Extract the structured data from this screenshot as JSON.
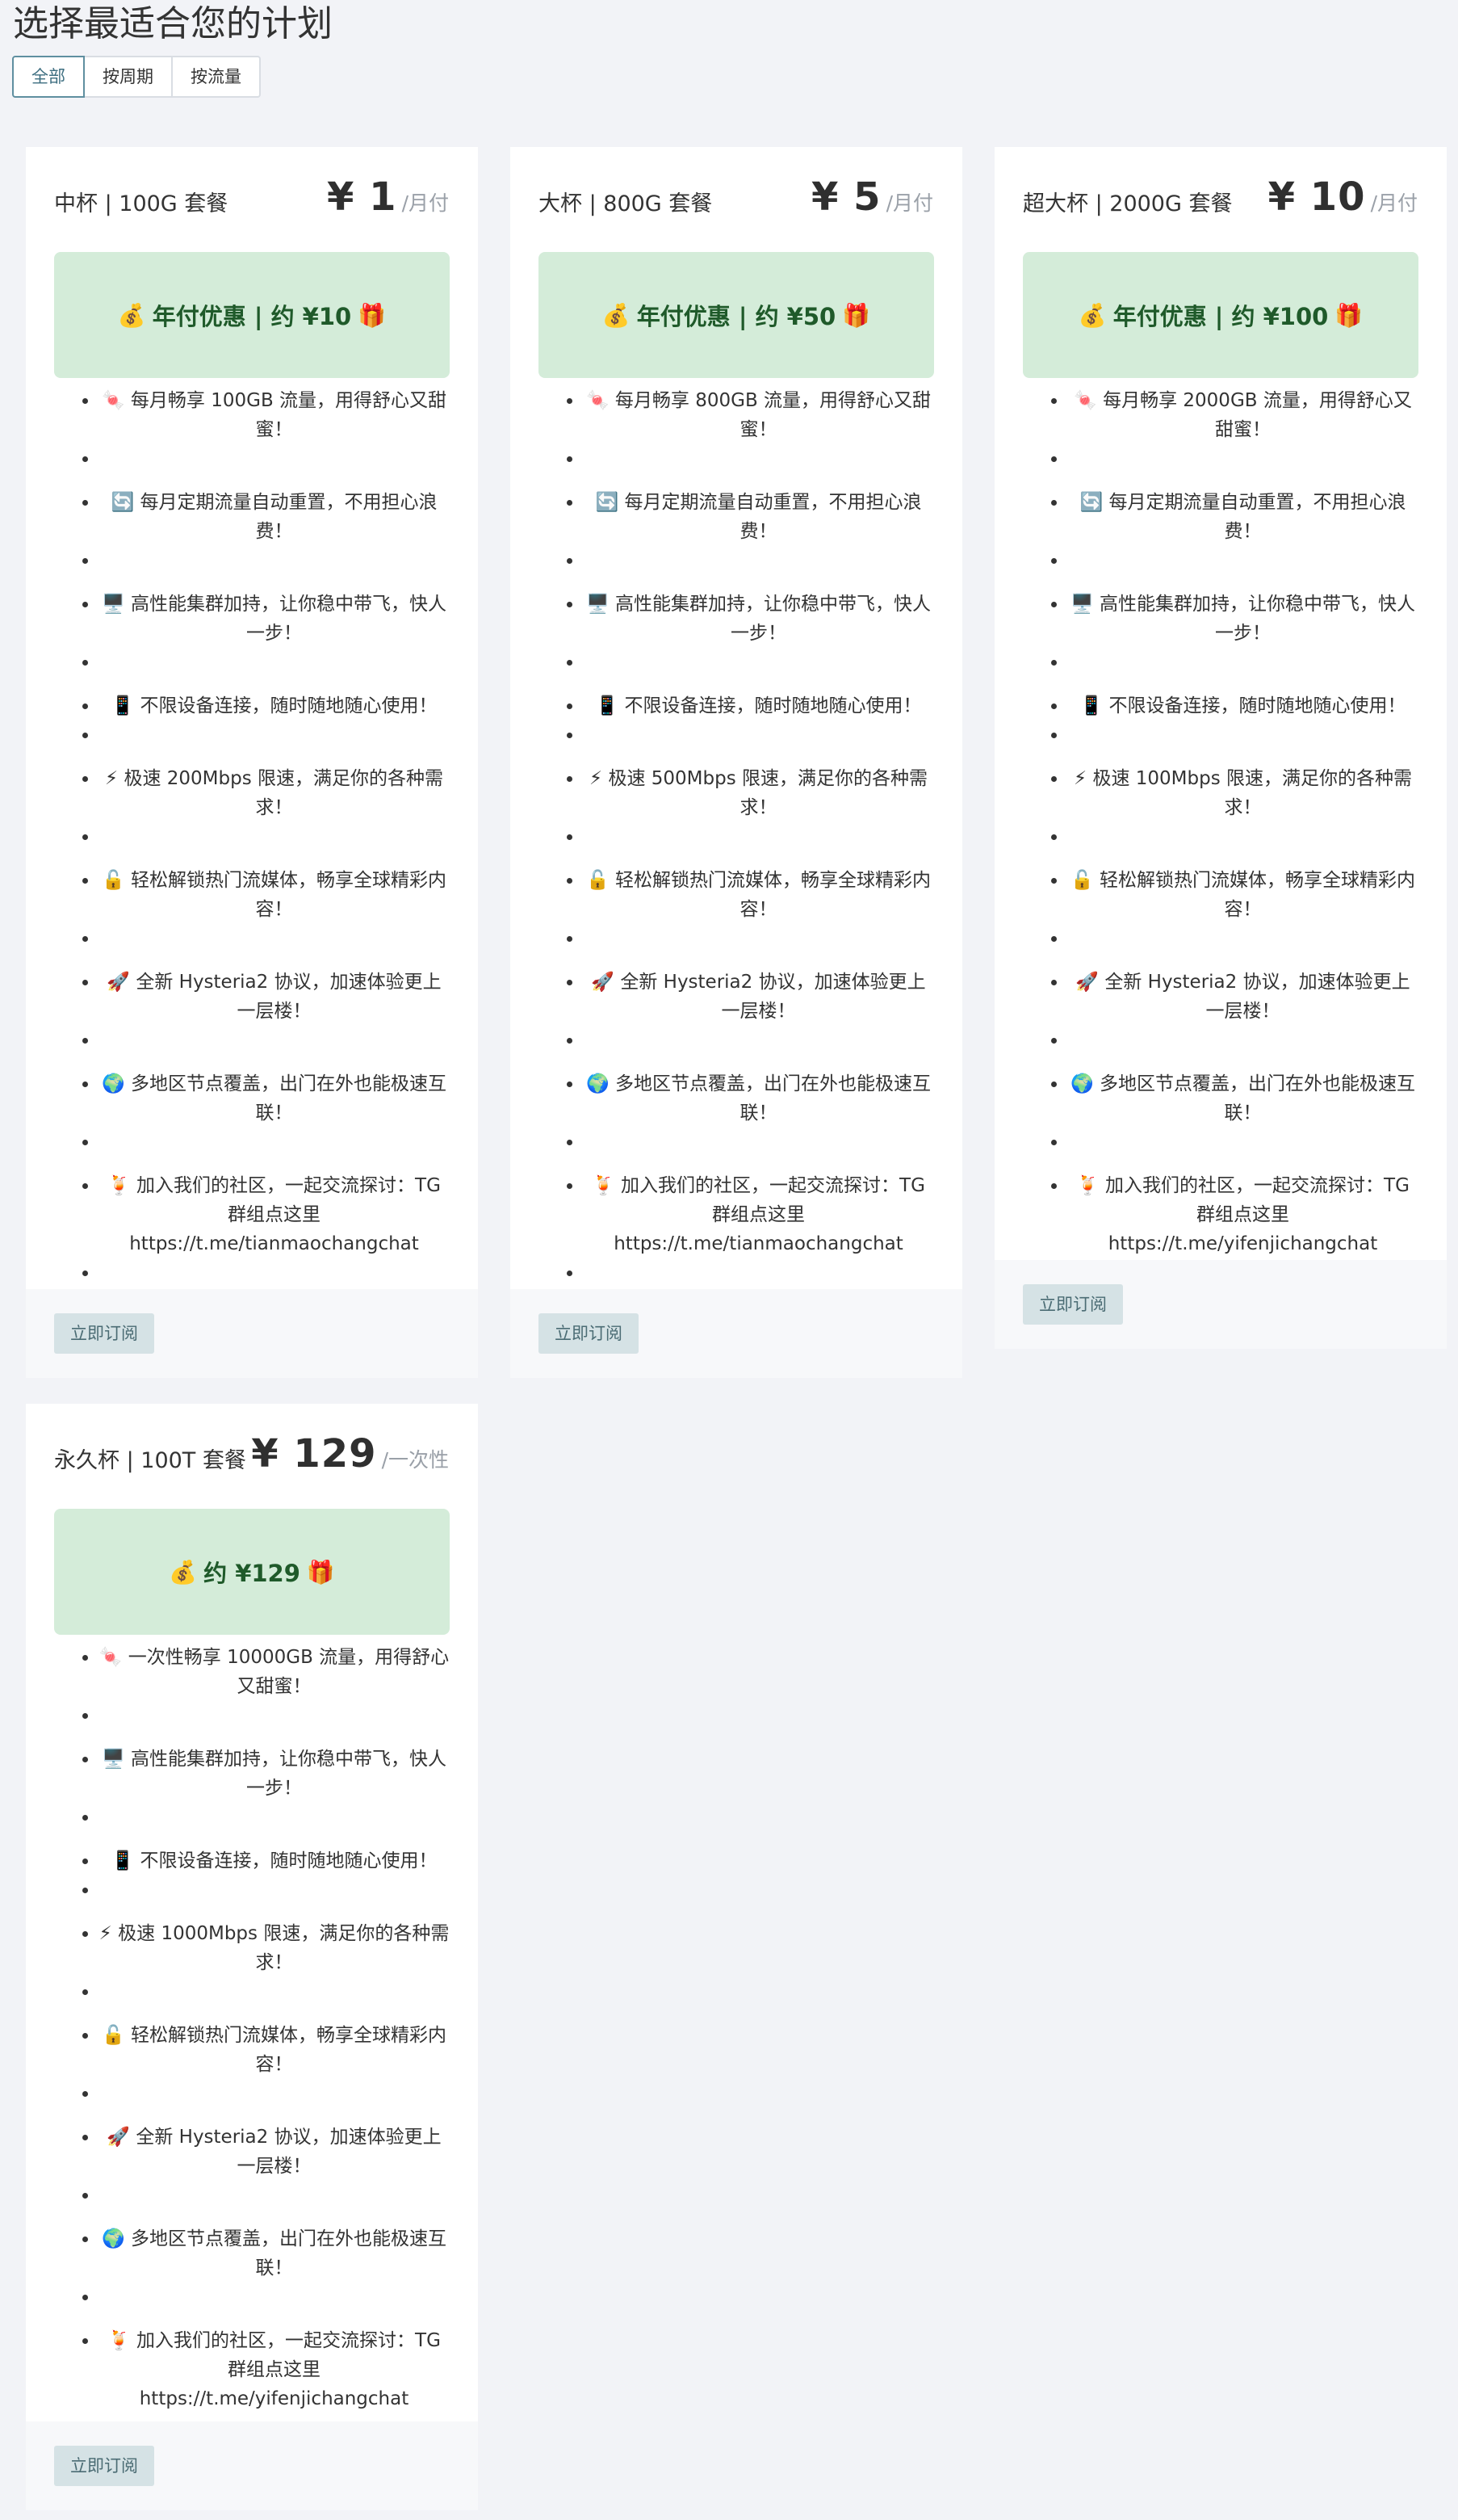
{
  "page": {
    "title": "选择最适合您的计划"
  },
  "tabs": [
    {
      "label": "全部",
      "active": true
    },
    {
      "label": "按周期"
    },
    {
      "label": "按流量"
    }
  ],
  "plans": [
    {
      "name": "中杯 | 100G 套餐",
      "price": "¥ 1",
      "unit": "/月付",
      "promo": "年付优惠 | 约 ¥10",
      "promo_left_emoji": "💰",
      "promo_right_emoji": "🎁",
      "features": [
        {
          "emoji": "🍬",
          "text": "每月畅享 100GB 流量，用得舒心又甜蜜！"
        },
        {
          "emoji": "🔄",
          "text": "每月定期流量自动重置，不用担心浪费！"
        },
        {
          "emoji": "🖥️",
          "text": "高性能集群加持，让你稳中带飞，快人一步！"
        },
        {
          "emoji": "📱",
          "text": "不限设备连接，随时随地随心使用！"
        },
        {
          "emoji": "⚡",
          "text": "极速 200Mbps 限速，满足你的各种需求！"
        },
        {
          "emoji": "🔓",
          "text": "轻松解锁热门流媒体，畅享全球精彩内容！"
        },
        {
          "emoji": "🚀",
          "text": "全新 Hysteria2 协议，加速体验更上一层楼！"
        },
        {
          "emoji": "🌍",
          "text": "多地区节点覆盖，出门在外也能极速互联！"
        },
        {
          "emoji": "🍹",
          "text": "加入我们的社区，一起交流探讨：TG群组点这里 https://t.me/tianmaochangchat"
        }
      ],
      "button": "立即订阅"
    },
    {
      "name": "大杯 | 800G 套餐",
      "price": "¥ 5",
      "unit": "/月付",
      "promo": "年付优惠 | 约 ¥50",
      "promo_left_emoji": "💰",
      "promo_right_emoji": "🎁",
      "features": [
        {
          "emoji": "🍬",
          "text": "每月畅享 800GB 流量，用得舒心又甜蜜！"
        },
        {
          "emoji": "🔄",
          "text": "每月定期流量自动重置，不用担心浪费！"
        },
        {
          "emoji": "🖥️",
          "text": "高性能集群加持，让你稳中带飞，快人一步！"
        },
        {
          "emoji": "📱",
          "text": "不限设备连接，随时随地随心使用！"
        },
        {
          "emoji": "⚡",
          "text": "极速 500Mbps 限速，满足你的各种需求！"
        },
        {
          "emoji": "🔓",
          "text": "轻松解锁热门流媒体，畅享全球精彩内容！"
        },
        {
          "emoji": "🚀",
          "text": "全新 Hysteria2 协议，加速体验更上一层楼！"
        },
        {
          "emoji": "🌍",
          "text": "多地区节点覆盖，出门在外也能极速互联！"
        },
        {
          "emoji": "🍹",
          "text": "加入我们的社区，一起交流探讨：TG群组点这里 https://t.me/tianmaochangchat"
        }
      ],
      "button": "立即订阅"
    },
    {
      "name": "超大杯 | 2000G 套餐",
      "price": "¥ 10",
      "unit": "/月付",
      "promo": "年付优惠 | 约 ¥100",
      "promo_left_emoji": "💰",
      "promo_right_emoji": "🎁",
      "features": [
        {
          "emoji": "🍬",
          "text": "每月畅享 2000GB 流量，用得舒心又甜蜜！"
        },
        {
          "emoji": "🔄",
          "text": "每月定期流量自动重置，不用担心浪费！"
        },
        {
          "emoji": "🖥️",
          "text": "高性能集群加持，让你稳中带飞，快人一步！"
        },
        {
          "emoji": "📱",
          "text": "不限设备连接，随时随地随心使用！"
        },
        {
          "emoji": "⚡",
          "text": "极速 100Mbps 限速，满足你的各种需求！"
        },
        {
          "emoji": "🔓",
          "text": "轻松解锁热门流媒体，畅享全球精彩内容！"
        },
        {
          "emoji": "🚀",
          "text": "全新 Hysteria2 协议，加速体验更上一层楼！"
        },
        {
          "emoji": "🌍",
          "text": "多地区节点覆盖，出门在外也能极速互联！"
        },
        {
          "emoji": "🍹",
          "text": "加入我们的社区，一起交流探讨：TG群组点这里https://t.me/yifenjichangchat"
        }
      ],
      "button": "立即订阅"
    },
    {
      "name": "永久杯 | 100T 套餐",
      "price": "¥ 129",
      "unit": "/一次性",
      "promo": "约 ¥129",
      "promo_left_emoji": "💰",
      "promo_right_emoji": "🎁",
      "features": [
        {
          "emoji": "🍬",
          "text": "一次性畅享 10000GB 流量，用得舒心又甜蜜！"
        },
        {
          "emoji": "🖥️",
          "text": "高性能集群加持，让你稳中带飞，快人一步！"
        },
        {
          "emoji": "📱",
          "text": "不限设备连接，随时随地随心使用！"
        },
        {
          "emoji": "⚡",
          "text": "极速 1000Mbps 限速，满足你的各种需求！"
        },
        {
          "emoji": "🔓",
          "text": "轻松解锁热门流媒体，畅享全球精彩内容！"
        },
        {
          "emoji": "🚀",
          "text": "全新 Hysteria2 协议，加速体验更上一层楼！"
        },
        {
          "emoji": "🌍",
          "text": "多地区节点覆盖，出门在外也能极速互联！"
        },
        {
          "emoji": "🍹",
          "text": "加入我们的社区，一起交流探讨：TG群组点这里https://t.me/yifenjichangchat"
        }
      ],
      "button": "立即订阅"
    }
  ]
}
